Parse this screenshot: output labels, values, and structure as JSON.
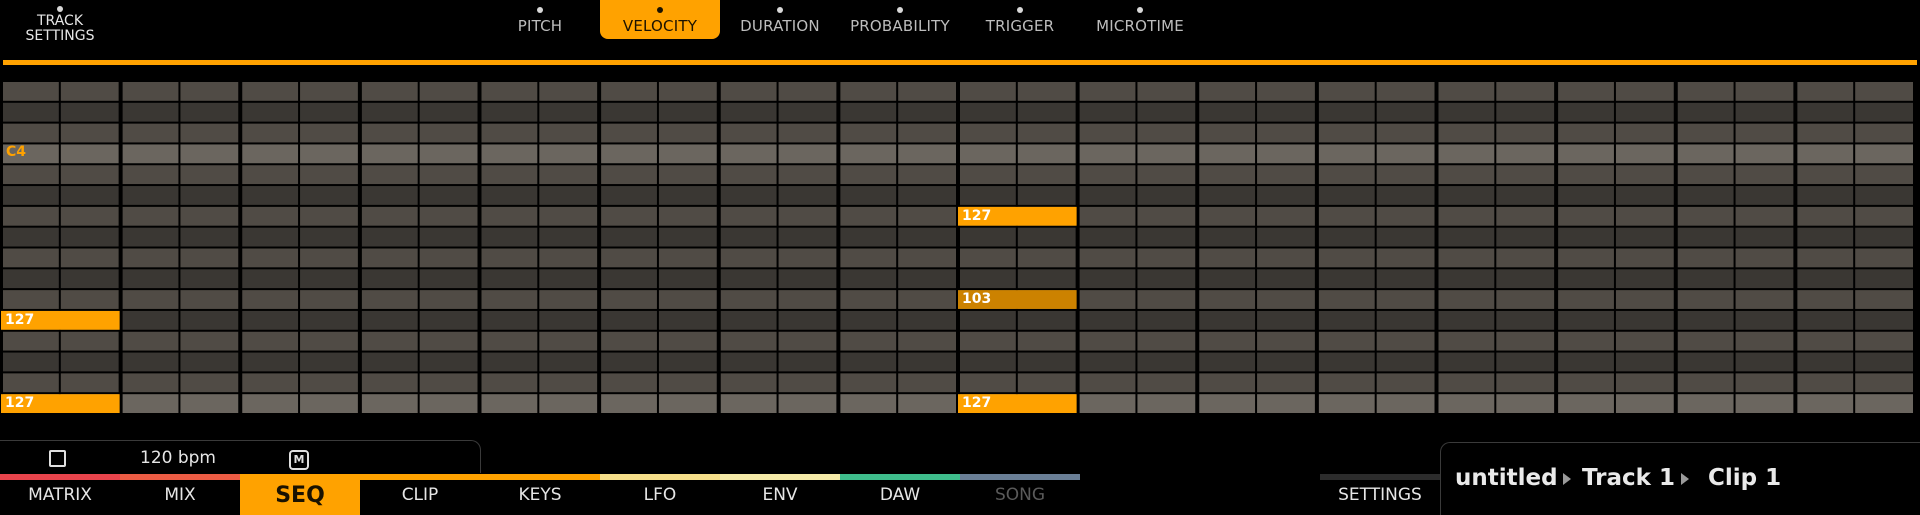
{
  "top_bar": {
    "track_settings_label": "TRACK\nSETTINGS",
    "tabs": [
      {
        "label": "PITCH",
        "active": false
      },
      {
        "label": "VELOCITY",
        "active": true
      },
      {
        "label": "DURATION",
        "active": false
      },
      {
        "label": "PROBABILITY",
        "active": false
      },
      {
        "label": "TRIGGER",
        "active": false
      },
      {
        "label": "MICROTIME",
        "active": false
      }
    ]
  },
  "grid": {
    "steps": 32,
    "rows": 16,
    "root_note_label": "C4",
    "root_row": 3,
    "notes": [
      {
        "row": 11,
        "step": 0,
        "length": 2,
        "velocity": "127",
        "color": "#ffa200"
      },
      {
        "row": 15,
        "step": 0,
        "length": 2,
        "velocity": "127",
        "color": "#ffa200"
      },
      {
        "row": 6,
        "step": 16,
        "length": 2,
        "velocity": "127",
        "color": "#ffa200"
      },
      {
        "row": 10,
        "step": 16,
        "length": 2,
        "velocity": "103",
        "color": "#cc8200"
      },
      {
        "row": 15,
        "step": 16,
        "length": 2,
        "velocity": "127",
        "color": "#ffa200"
      }
    ],
    "colors": {
      "dark_row": "#3a3733",
      "light_row": "#504b45",
      "highlight_row": "#6b665f",
      "accent": "#ffa200"
    }
  },
  "transport": {
    "stop_icon": "stop-square-icon",
    "bpm_text": "120 bpm",
    "metronome_label": "M"
  },
  "bottom_nav": {
    "items": [
      {
        "label": "MATRIX",
        "color": "#e8444c",
        "active": false,
        "disabled": false
      },
      {
        "label": "MIX",
        "color": "#ec5c44",
        "active": false,
        "disabled": false
      },
      {
        "label": "SEQ",
        "color": "#ffa200",
        "active": true,
        "disabled": false
      },
      {
        "label": "CLIP",
        "color": "#ffa200",
        "active": false,
        "disabled": false
      },
      {
        "label": "KEYS",
        "color": "#ffa200",
        "active": false,
        "disabled": false
      },
      {
        "label": "LFO",
        "color": "#f6df8a",
        "active": false,
        "disabled": false
      },
      {
        "label": "ENV",
        "color": "#f4eaa8",
        "active": false,
        "disabled": false
      },
      {
        "label": "DAW",
        "color": "#3fbd8c",
        "active": false,
        "disabled": false
      },
      {
        "label": "SONG",
        "color": "#6a7f96",
        "active": false,
        "disabled": true
      }
    ],
    "settings_label": "SETTINGS"
  },
  "breadcrumb": {
    "project": "untitled",
    "track": "Track 1",
    "clip": "Clip 1"
  }
}
